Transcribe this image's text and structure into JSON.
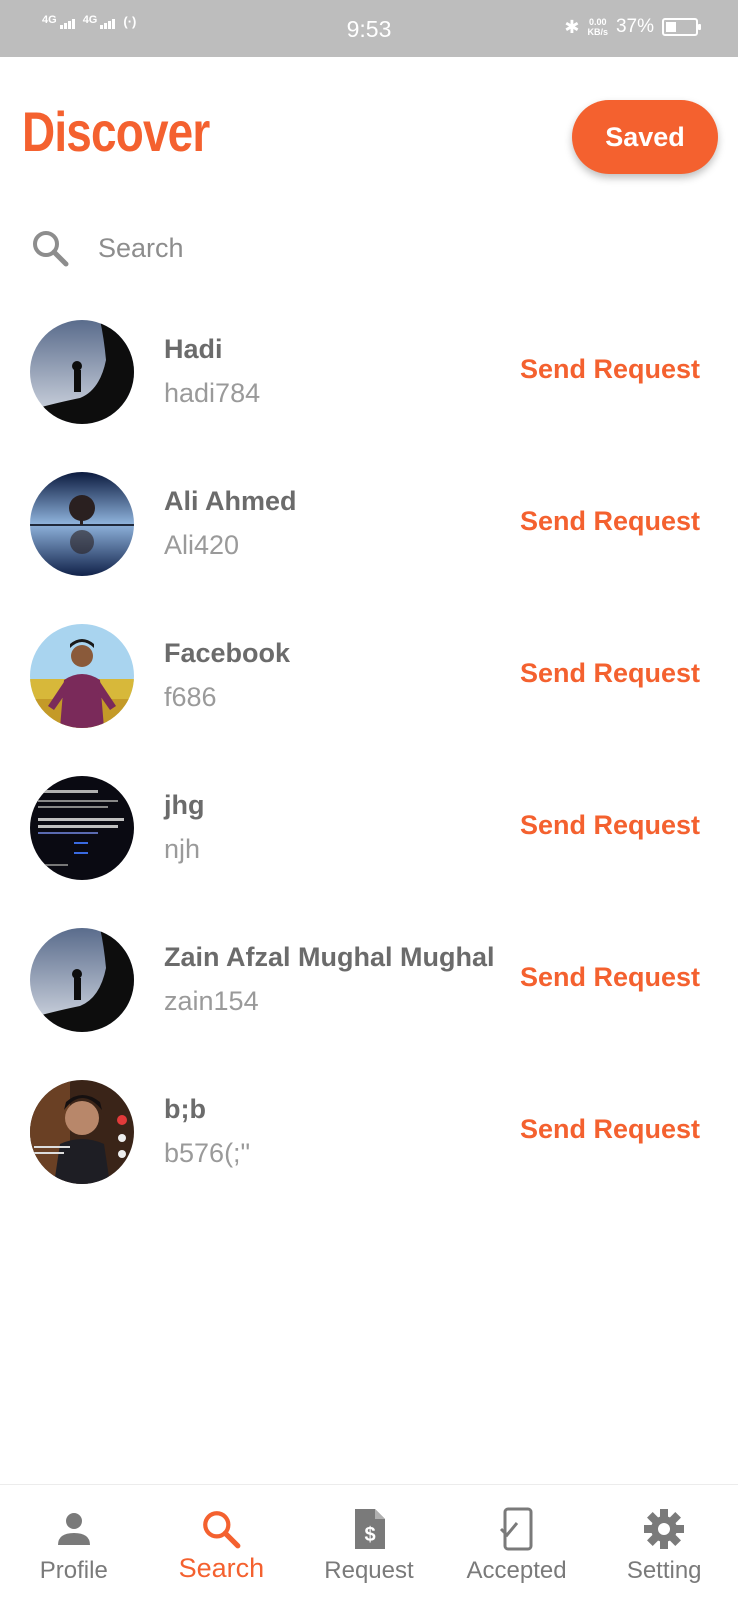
{
  "status_bar": {
    "network_1": "4G",
    "network_2": "4G",
    "time": "9:53",
    "speed_value": "0.00",
    "speed_unit": "KB/s",
    "battery": "37%",
    "battery_level": 0.37
  },
  "header": {
    "title": "Discover",
    "saved_label": "Saved"
  },
  "search": {
    "placeholder": "Search"
  },
  "users": [
    {
      "name": "Hadi",
      "handle": "hadi784",
      "action": "Send Request"
    },
    {
      "name": "Ali Ahmed",
      "handle": "Ali420",
      "action": "Send Request"
    },
    {
      "name": "Facebook",
      "handle": "f686",
      "action": "Send Request"
    },
    {
      "name": "jhg",
      "handle": "njh",
      "action": "Send Request"
    },
    {
      "name": "Zain Afzal Mughal Mughal",
      "handle": "zain154",
      "action": "Send Request"
    },
    {
      "name": "b;b",
      "handle": "b576(;\"",
      "action": "Send Request"
    }
  ],
  "bottom_nav": [
    {
      "label": "Profile",
      "icon": "person-icon"
    },
    {
      "label": "Search",
      "icon": "search-icon"
    },
    {
      "label": "Request",
      "icon": "dollar-document-icon"
    },
    {
      "label": "Accepted",
      "icon": "phone-check-icon"
    },
    {
      "label": "Setting",
      "icon": "gear-icon"
    }
  ],
  "colors": {
    "accent": "#f4612f",
    "status_bar": "#bdbdbd"
  }
}
